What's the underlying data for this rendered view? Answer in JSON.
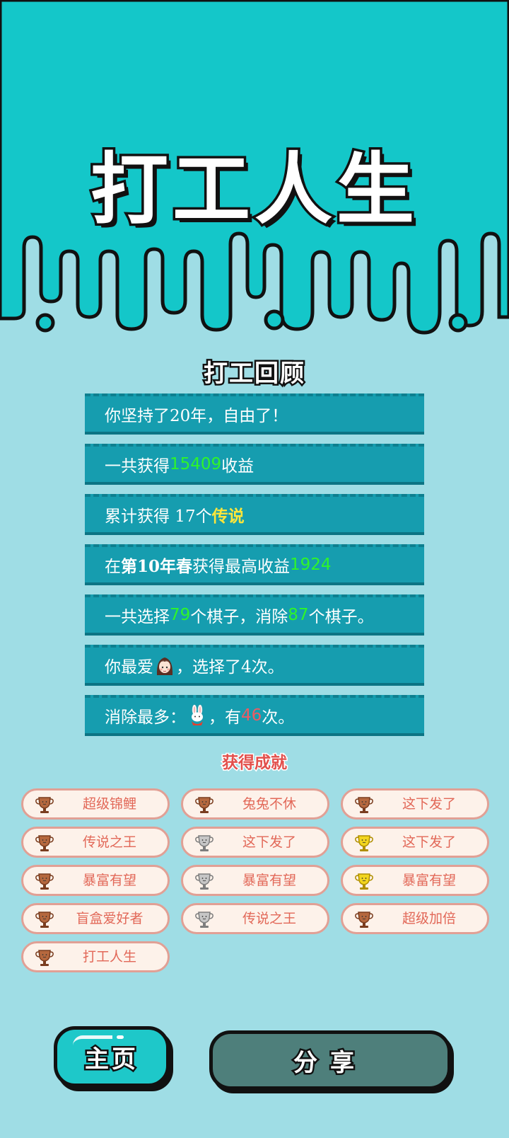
{
  "header": {
    "app_title": "打工人生"
  },
  "colors": {
    "header_teal": "#14c7c9",
    "page_bg": "#9fdde5",
    "row_bg": "#169daf",
    "highlight_green": "#2ef52a",
    "highlight_yellow": "#ffe63a",
    "highlight_red": "#ee5b63",
    "achievement_title": "#e2504c",
    "share_button": "#4e7f7b"
  },
  "review": {
    "title": "打工回顾",
    "rows": [
      {
        "text": "你坚持了20年，自由了！"
      },
      {
        "pre": "一共获得",
        "value": "15409",
        "post": "收益"
      },
      {
        "pre": "累计获得 17个",
        "value": "传说"
      },
      {
        "pre": "在 ",
        "bold": "第10年春",
        "mid": " 获得最高收益",
        "value": "1924"
      },
      {
        "pre": "一共选择",
        "value1": "79",
        "mid": "个棋子，消除",
        "value2": "87",
        "post": "个棋子。"
      },
      {
        "pre": "你最爱",
        "icon": "girl-avatar-icon",
        "post": "，选择了4次。"
      },
      {
        "pre": "消除最多：",
        "icon": "rabbit-icon",
        "mid": "，有",
        "value": "46",
        "post": "次。"
      }
    ]
  },
  "achievements": {
    "title": "获得成就",
    "badges": [
      {
        "label": "超级锦鲤",
        "trophy": "bronze-trophy-icon"
      },
      {
        "label": "兔兔不休",
        "trophy": "bronze-trophy-icon"
      },
      {
        "label": "这下发了",
        "trophy": "bronze-trophy-icon"
      },
      {
        "label": "传说之王",
        "trophy": "bronze-trophy-icon"
      },
      {
        "label": "这下发了",
        "trophy": "silver-trophy-icon"
      },
      {
        "label": "这下发了",
        "trophy": "gold-trophy-icon"
      },
      {
        "label": "暴富有望",
        "trophy": "bronze-trophy-icon"
      },
      {
        "label": "暴富有望",
        "trophy": "silver-trophy-icon"
      },
      {
        "label": "暴富有望",
        "trophy": "gold-trophy-icon"
      },
      {
        "label": "盲盒爱好者",
        "trophy": "bronze-trophy-icon"
      },
      {
        "label": "传说之王",
        "trophy": "silver-trophy-icon"
      },
      {
        "label": "超级加倍",
        "trophy": "bronze-trophy-icon"
      },
      {
        "label": "打工人生",
        "trophy": "bronze-trophy-icon"
      }
    ]
  },
  "buttons": {
    "home_label": "主页",
    "share_label": "分享"
  }
}
